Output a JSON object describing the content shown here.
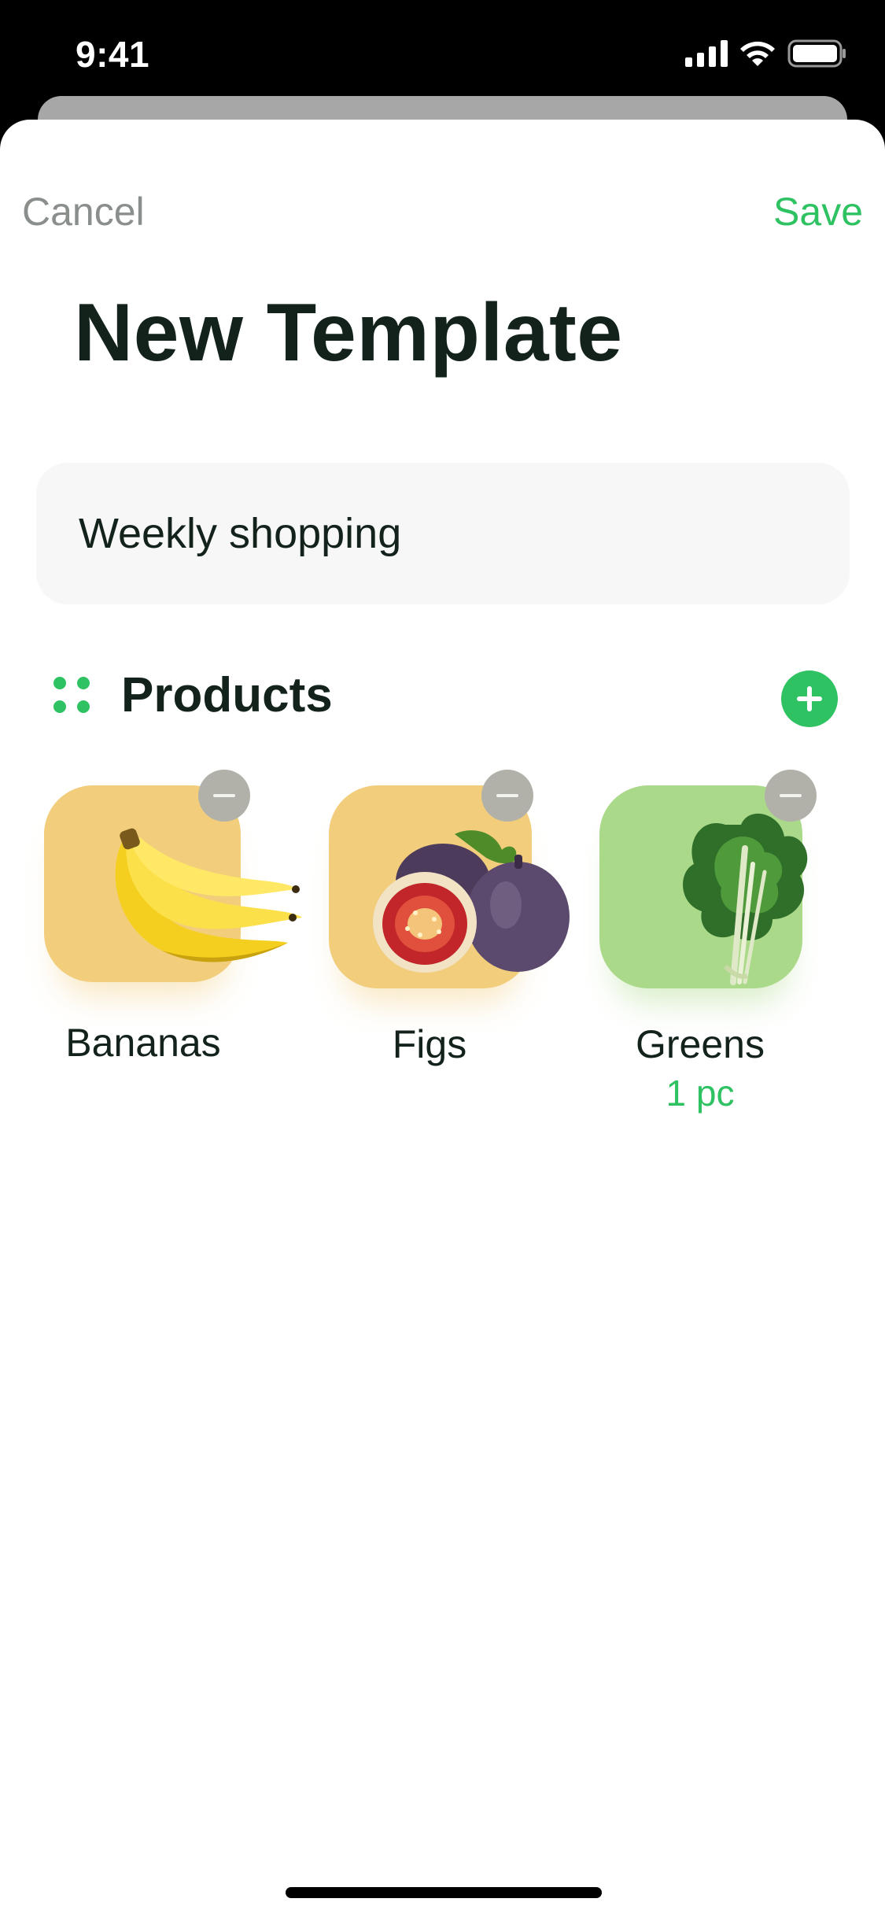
{
  "status_bar": {
    "time": "9:41",
    "icons": [
      "cellular-signal-icon",
      "wifi-icon",
      "battery-icon"
    ]
  },
  "nav": {
    "cancel_label": "Cancel",
    "save_label": "Save"
  },
  "page": {
    "title": "New Template"
  },
  "template_name": {
    "value": "Weekly shopping"
  },
  "products_section": {
    "label": "Products",
    "drag_icon": "drag-handle-icon",
    "add_icon": "plus-icon",
    "items": [
      {
        "name": "Bananas",
        "quantity": "",
        "image": "bananas-image",
        "tile_color": "#f1cd7c"
      },
      {
        "name": "Figs",
        "quantity": "",
        "image": "figs-image",
        "tile_color": "#f1cd7c"
      },
      {
        "name": "Greens",
        "quantity": "1 pc",
        "image": "greens-image",
        "tile_color": "#aad98a"
      }
    ]
  },
  "colors": {
    "accent": "#2ec262",
    "text_primary": "#13231b",
    "text_secondary": "#8a8f8c",
    "field_background": "#f7f7f7"
  }
}
